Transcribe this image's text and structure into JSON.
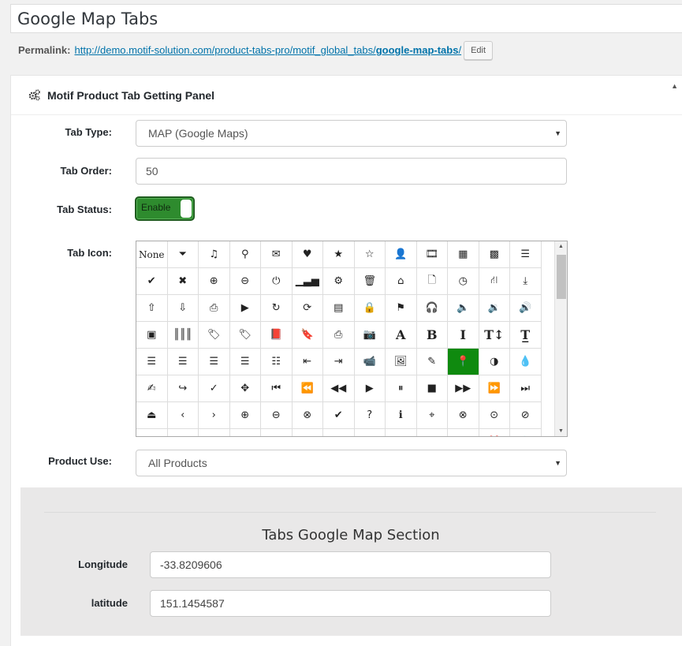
{
  "post_title": "Google Map Tabs",
  "permalink": {
    "label": "Permalink:",
    "url_prefix": "http://demo.motif-solution.com/product-tabs-pro/motif_global_tabs/",
    "url_slug": "google-map-tabs",
    "url_suffix": "/",
    "edit_label": "Edit"
  },
  "panel": {
    "title": "Motif Product Tab Getting Panel",
    "tab_type": {
      "label": "Tab Type:",
      "value": "MAP (Google Maps)"
    },
    "tab_order": {
      "label": "Tab Order:",
      "value": "50"
    },
    "tab_status": {
      "label": "Tab Status:",
      "value": "Enable"
    },
    "tab_icon": {
      "label": "Tab Icon:",
      "selected": "map-marker",
      "rows": [
        [
          {
            "n": "none",
            "g": "None",
            "t": "word"
          },
          {
            "n": "filter",
            "g": "⏷"
          },
          {
            "n": "music",
            "g": "♫"
          },
          {
            "n": "search",
            "g": "⚲"
          },
          {
            "n": "envelope",
            "g": "✉"
          },
          {
            "n": "heart",
            "g": "♥"
          },
          {
            "n": "star",
            "g": "★"
          },
          {
            "n": "star-empty",
            "g": "☆"
          },
          {
            "n": "user",
            "g": "👤"
          },
          {
            "n": "film",
            "g": "🎞"
          },
          {
            "n": "th-large",
            "g": "▦"
          },
          {
            "n": "th",
            "g": "▩"
          },
          {
            "n": "th-list",
            "g": "☰"
          }
        ],
        [
          {
            "n": "ok",
            "g": "✔"
          },
          {
            "n": "remove",
            "g": "✖"
          },
          {
            "n": "zoom-in",
            "g": "⊕"
          },
          {
            "n": "zoom-out",
            "g": "⊖"
          },
          {
            "n": "off",
            "g": "⏻"
          },
          {
            "n": "signal",
            "g": "▁▃▅"
          },
          {
            "n": "cog",
            "g": "⚙"
          },
          {
            "n": "trash",
            "g": "🗑"
          },
          {
            "n": "home",
            "g": "⌂"
          },
          {
            "n": "file",
            "g": "🗋"
          },
          {
            "n": "time",
            "g": "◷"
          },
          {
            "n": "road",
            "g": "⛙"
          },
          {
            "n": "download-alt",
            "g": "⤓"
          }
        ],
        [
          {
            "n": "upload",
            "g": "⇧"
          },
          {
            "n": "download",
            "g": "⇩"
          },
          {
            "n": "inbox",
            "g": "⎙"
          },
          {
            "n": "play-circle",
            "g": "▶"
          },
          {
            "n": "repeat",
            "g": "↻"
          },
          {
            "n": "refresh",
            "g": "⟳"
          },
          {
            "n": "list-alt",
            "g": "▤"
          },
          {
            "n": "lock",
            "g": "🔒"
          },
          {
            "n": "flag",
            "g": "⚑"
          },
          {
            "n": "headphones",
            "g": "🎧"
          },
          {
            "n": "volume-off",
            "g": "🔈"
          },
          {
            "n": "volume-down",
            "g": "🔉"
          },
          {
            "n": "volume-up",
            "g": "🔊"
          }
        ],
        [
          {
            "n": "qrcode",
            "g": "▣"
          },
          {
            "n": "barcode",
            "g": "║║║"
          },
          {
            "n": "tag",
            "g": "🏷"
          },
          {
            "n": "tags",
            "g": "🏷"
          },
          {
            "n": "book",
            "g": "📕"
          },
          {
            "n": "bookmark",
            "g": "🔖"
          },
          {
            "n": "print",
            "g": "⎙"
          },
          {
            "n": "camera",
            "g": "📷"
          },
          {
            "n": "font",
            "g": "A",
            "t": "serif"
          },
          {
            "n": "bold",
            "g": "B",
            "t": "serif"
          },
          {
            "n": "italic",
            "g": "I",
            "t": "serif"
          },
          {
            "n": "text-height",
            "g": "T↕",
            "t": "serif"
          },
          {
            "n": "text-width",
            "g": "T̲",
            "t": "serif"
          }
        ],
        [
          {
            "n": "align-left",
            "g": "☰"
          },
          {
            "n": "align-center",
            "g": "☰"
          },
          {
            "n": "align-right",
            "g": "☰"
          },
          {
            "n": "align-justify",
            "g": "☰"
          },
          {
            "n": "list",
            "g": "☷"
          },
          {
            "n": "indent-left",
            "g": "⇤"
          },
          {
            "n": "indent-right",
            "g": "⇥"
          },
          {
            "n": "facetime-video",
            "g": "📹"
          },
          {
            "n": "picture",
            "g": "🖼"
          },
          {
            "n": "pencil",
            "g": "✎"
          },
          {
            "n": "map-marker",
            "g": "📍"
          },
          {
            "n": "adjust",
            "g": "◑"
          },
          {
            "n": "tint",
            "g": "💧"
          }
        ],
        [
          {
            "n": "edit",
            "g": "✍"
          },
          {
            "n": "share",
            "g": "↪"
          },
          {
            "n": "check",
            "g": "✓"
          },
          {
            "n": "move",
            "g": "✥"
          },
          {
            "n": "step-backward",
            "g": "⏮"
          },
          {
            "n": "fast-backward",
            "g": "⏪"
          },
          {
            "n": "backward",
            "g": "◀◀"
          },
          {
            "n": "play",
            "g": "▶"
          },
          {
            "n": "pause",
            "g": "⏸"
          },
          {
            "n": "stop",
            "g": "■"
          },
          {
            "n": "forward",
            "g": "▶▶"
          },
          {
            "n": "fast-forward",
            "g": "⏩"
          },
          {
            "n": "step-forward",
            "g": "⏭"
          }
        ],
        [
          {
            "n": "eject",
            "g": "⏏"
          },
          {
            "n": "chevron-left",
            "g": "‹"
          },
          {
            "n": "chevron-right",
            "g": "›"
          },
          {
            "n": "plus-sign",
            "g": "⊕"
          },
          {
            "n": "minus-sign",
            "g": "⊖"
          },
          {
            "n": "remove-sign",
            "g": "⊗"
          },
          {
            "n": "ok-sign",
            "g": "✔"
          },
          {
            "n": "question-sign",
            "g": "?"
          },
          {
            "n": "info-sign",
            "g": "ℹ"
          },
          {
            "n": "screenshot",
            "g": "⌖"
          },
          {
            "n": "remove-circle",
            "g": "⊗"
          },
          {
            "n": "ok-circle",
            "g": "⊙"
          },
          {
            "n": "ban-circle",
            "g": "⊘"
          }
        ],
        [
          {
            "n": "arrow-left",
            "g": "←"
          },
          {
            "n": "arrow-right",
            "g": "→"
          },
          {
            "n": "arrow-up",
            "g": "↑"
          },
          {
            "n": "arrow-down",
            "g": "↓"
          },
          {
            "n": "share-alt",
            "g": "↗"
          },
          {
            "n": "resize-full",
            "g": "⤢"
          },
          {
            "n": "resize-small",
            "g": "⤡"
          },
          {
            "n": "plus",
            "g": "+"
          },
          {
            "n": "minus",
            "g": "−"
          },
          {
            "n": "asterisk",
            "g": "*"
          },
          {
            "n": "exclamation-sign",
            "g": "!"
          },
          {
            "n": "gift",
            "g": "🎁"
          },
          {
            "n": "leaf",
            "g": "🍃"
          }
        ]
      ]
    },
    "product_use": {
      "label": "Product Use:",
      "value": "All Products"
    }
  },
  "map_section": {
    "title": "Tabs Google Map Section",
    "longitude": {
      "label": "Longitude",
      "value": "-33.8209606"
    },
    "latitude": {
      "label": "latitude",
      "value": "151.1454587"
    }
  },
  "colors": {
    "selected_icon_bg": "#0f8a0f",
    "toggle_on": "#2e8b2e",
    "link": "#0073aa"
  }
}
